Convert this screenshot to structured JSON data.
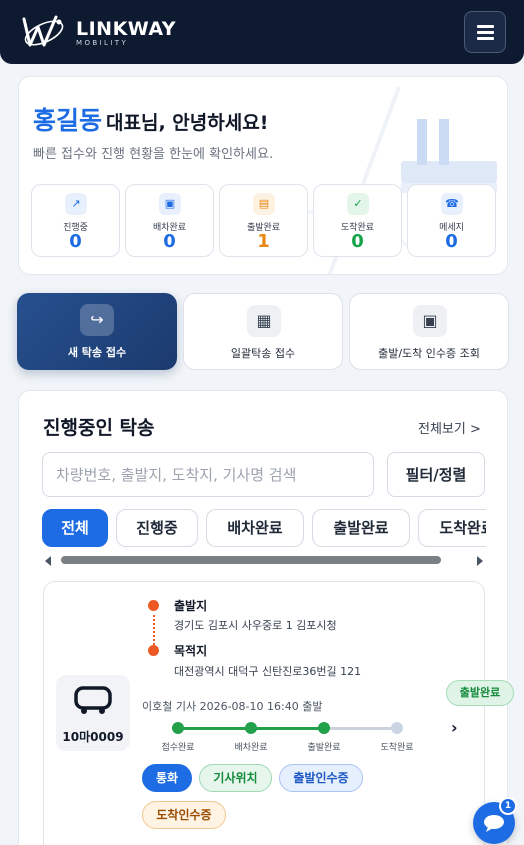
{
  "header": {
    "brand": "LINKWAY",
    "brand_sub": "MOBILITY",
    "colors": {
      "bg": "#0e1a30"
    }
  },
  "greeting": {
    "name": "홍길동",
    "text": "대표님, 안녕하세요!",
    "subtitle": "빠른 접수와 진행 현황을 한눈에 확인하세요."
  },
  "stats": [
    {
      "label": "진행중",
      "value": "0",
      "icon": "arrow-up-right-icon",
      "color": "#1d6ce4"
    },
    {
      "label": "배차완료",
      "value": "0",
      "icon": "square-icon",
      "color": "#1d6ce4"
    },
    {
      "label": "출발완료",
      "value": "1",
      "icon": "list-icon",
      "color": "#e8880e"
    },
    {
      "label": "도착완료",
      "value": "0",
      "icon": "check-icon",
      "color": "#16a34a"
    },
    {
      "label": "메세지",
      "value": "0",
      "icon": "phone-icon",
      "color": "#1d6ce4"
    }
  ],
  "actions": [
    {
      "label": "새 탁송 접수",
      "icon": "redirect-arrow-icon"
    },
    {
      "label": "일괄탁송 접수",
      "icon": "grid-icon"
    },
    {
      "label": "출발/도착 인수증 조회",
      "icon": "document-icon"
    }
  ],
  "main": {
    "title": "진행중인 탁송",
    "see_all": "전체보기 >",
    "search_placeholder": "차량번호, 출발지, 도착지, 기사명 검색",
    "filter_label": "필터/정렬",
    "tabs": [
      "전체",
      "진행중",
      "배차완료",
      "출발완료",
      "도착완료"
    ]
  },
  "trip": {
    "plate": "10마0009",
    "origin_title": "출발지",
    "origin_addr": "경기도 김포시 사우중로 1 김포시청",
    "dest_title": "목적지",
    "dest_addr": "대전광역시 대덕구 신탄진로36번길 121",
    "driver_line": "이호철 기사   2026-08-10 16:40 출발",
    "status": "출발완료",
    "steps": [
      "접수완료",
      "배차완료",
      "출발완료",
      "도착완료"
    ],
    "buttons": {
      "call": "통화",
      "location": "기사위치",
      "departure_receipt": "출발인수증",
      "arrival_receipt": "도착인수증"
    }
  },
  "chat": {
    "badge": "1"
  }
}
